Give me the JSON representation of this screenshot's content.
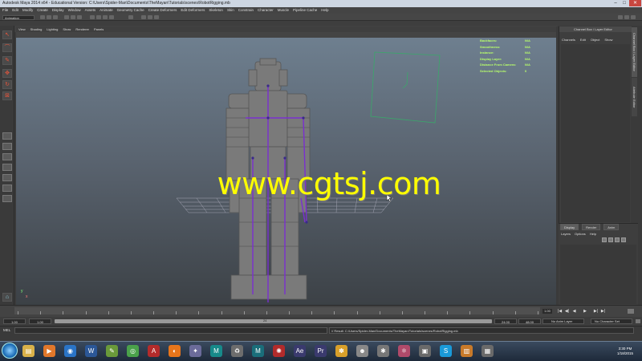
{
  "window": {
    "title": "Autodesk Maya 2014 x64 - Educational Version: C:\\Users\\Spider-Man\\Documents\\TheMayan\\Tutorials\\scenes\\RobotRigging.mb",
    "min": "–",
    "max": "□",
    "close": "✕"
  },
  "menubar": [
    "File",
    "Edit",
    "Modify",
    "Create",
    "Display",
    "Window",
    "Assets",
    "Animate",
    "Geometry Cache",
    "Create Deformers",
    "Edit Deformers",
    "Skeleton",
    "Skin",
    "Constrain",
    "Character",
    "Muscle",
    "Pipeline Cache",
    "Help"
  ],
  "status_line": {
    "mode": "Animation"
  },
  "panel_menu": [
    "View",
    "Shading",
    "Lighting",
    "Show",
    "Renderer",
    "Panels"
  ],
  "hud": [
    {
      "label": "Backfaces:",
      "value": "N/A"
    },
    {
      "label": "Smoothness:",
      "value": "N/A"
    },
    {
      "label": "Instance:",
      "value": "N/A"
    },
    {
      "label": "Display Layer:",
      "value": "N/A"
    },
    {
      "label": "Distance From Camera:",
      "value": "N/A"
    },
    {
      "label": "Selected Objects:",
      "value": "0"
    }
  ],
  "watermark": "www.cgtsj.com",
  "axis": {
    "x": "x",
    "y": "y"
  },
  "channel_box": {
    "title": "Channel Box / Layer Editor",
    "menu": [
      "Channels",
      "Edit",
      "Object",
      "Show"
    ]
  },
  "side_tabs": [
    "Channel Box / Layer Editor",
    "Attribute Editor"
  ],
  "layer_editor": {
    "tabs": [
      "Display",
      "Render",
      "Anim"
    ],
    "menu": [
      "Layers",
      "Options",
      "Help"
    ]
  },
  "timeline": {
    "ticks": [
      "1",
      "2",
      "3",
      "4",
      "5",
      "6",
      "7",
      "8",
      "9",
      "10",
      "11",
      "12",
      "13",
      "14",
      "15",
      "16",
      "17",
      "18",
      "19",
      "20",
      "21",
      "22",
      "23",
      "24"
    ],
    "current_frame": "1.00"
  },
  "playback": [
    "|◀",
    "◀|",
    "◀",
    "▶",
    "▶|",
    "▶|"
  ],
  "range": {
    "start_field": "1.00",
    "start_inner": "1.00",
    "range_label": "24",
    "end_inner": "24.00",
    "end_field": "48.00",
    "anim_layer": "No Anim Layer",
    "char_set": "No Character Set"
  },
  "cmdline": {
    "label": "MEL",
    "result": "// Result: C:/Users/Spider-Man/Documents/TheMayan/Tutorials/scenes/RobotRigging.mb"
  },
  "taskbar": {
    "icons": [
      {
        "name": "folder-icon",
        "glyph": "▤",
        "color": "#d8b14a"
      },
      {
        "name": "media-player-icon",
        "glyph": "▶",
        "color": "#e0772b"
      },
      {
        "name": "wmp-icon",
        "glyph": "◉",
        "color": "#2a74c7"
      },
      {
        "name": "word-icon",
        "glyph": "W",
        "color": "#2b5797"
      },
      {
        "name": "paint-icon",
        "glyph": "✎",
        "color": "#6a9a3a"
      },
      {
        "name": "chrome-icon",
        "glyph": "◎",
        "color": "#4aa14a"
      },
      {
        "name": "acrobat-icon",
        "glyph": "A",
        "color": "#b42b2b"
      },
      {
        "name": "firefox-icon",
        "glyph": "◐",
        "color": "#e8751a"
      },
      {
        "name": "store-icon",
        "glyph": "✦",
        "color": "#6b6b9a"
      },
      {
        "name": "maya-icon",
        "glyph": "M",
        "color": "#178a8a"
      },
      {
        "name": "recycle-icon",
        "glyph": "♻",
        "color": "#6d6d6d"
      },
      {
        "name": "maya2-icon",
        "glyph": "M",
        "color": "#1a6e7a"
      },
      {
        "name": "virus-icon",
        "glyph": "✺",
        "color": "#b22b2b"
      },
      {
        "name": "aftereffects-icon",
        "glyph": "Ae",
        "color": "#3a3a6e"
      },
      {
        "name": "premiere-icon",
        "glyph": "Pr",
        "color": "#3a3a6e"
      },
      {
        "name": "bugs-icon",
        "glyph": "✽",
        "color": "#d8a02a"
      },
      {
        "name": "mask-icon",
        "glyph": "☻",
        "color": "#888"
      },
      {
        "name": "tools-icon",
        "glyph": "✱",
        "color": "#777"
      },
      {
        "name": "atom-icon",
        "glyph": "⚛",
        "color": "#b04a6a"
      },
      {
        "name": "media-icon",
        "glyph": "▣",
        "color": "#6a6a6a"
      },
      {
        "name": "skype-icon",
        "glyph": "S",
        "color": "#1a9ad9"
      },
      {
        "name": "bag-icon",
        "glyph": "▥",
        "color": "#c87a2a"
      },
      {
        "name": "stamp-icon",
        "glyph": "▦",
        "color": "#6a6a6a"
      }
    ],
    "time": "3:30 PM",
    "date": "1/18/2015"
  }
}
